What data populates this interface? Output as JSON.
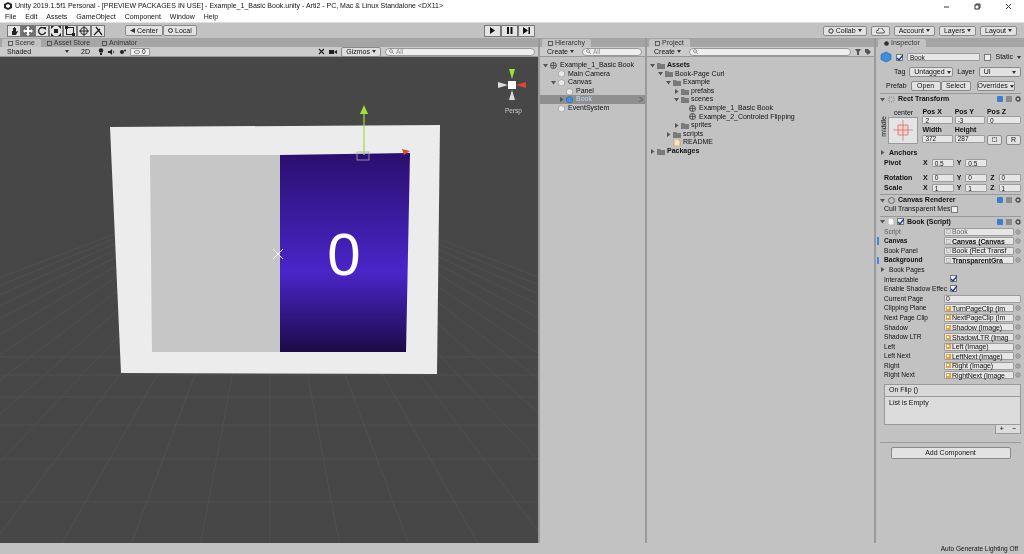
{
  "window": {
    "title": "Unity 2019.1.5f1 Personal - [PREVIEW PACKAGES IN USE] - Example_1_Basic Book.unity - Arti2 - PC, Mac & Linux Standalone <DX11>"
  },
  "menu": [
    "File",
    "Edit",
    "Assets",
    "GameObject",
    "Component",
    "Window",
    "Help"
  ],
  "toolbar": {
    "tools": [
      {
        "kind": "hand",
        "selected": false
      },
      {
        "kind": "move",
        "selected": true
      },
      {
        "kind": "rotate",
        "selected": false
      },
      {
        "kind": "scale",
        "selected": false
      },
      {
        "kind": "rect",
        "selected": false
      },
      {
        "kind": "transform",
        "selected": false
      },
      {
        "kind": "custom",
        "selected": false
      }
    ],
    "pivot": [
      {
        "kind": "pivot",
        "label": "Center"
      },
      {
        "kind": "space",
        "label": "Local"
      }
    ],
    "right": [
      {
        "kind": "collab",
        "label": "Collab"
      },
      {
        "kind": "cloud"
      },
      {
        "kind": "menu",
        "label": "Account"
      },
      {
        "kind": "menu",
        "label": "Layers"
      },
      {
        "kind": "menu",
        "label": "Layout"
      }
    ]
  },
  "scene": {
    "tabs": [
      {
        "label": "Scene",
        "selected": true
      },
      {
        "label": "Asset Store",
        "selected": false
      },
      {
        "label": "Animator",
        "selected": false
      }
    ],
    "shading": "Shaded",
    "mode_2d": "2D",
    "hidden_count": "0",
    "gizmos": "Gizmos",
    "search_placeholder": "All",
    "projection": "Persp",
    "page_number": "0"
  },
  "hierarchy": {
    "title": "Hierarchy",
    "create": "Create",
    "search_placeholder": "All",
    "items": [
      {
        "label": "Example_1_Basic Book",
        "kind": "scene",
        "expanded": true,
        "selected": false,
        "children": [
          {
            "label": "Main Camera",
            "kind": "object",
            "selected": false
          },
          {
            "label": "Canvas",
            "kind": "object",
            "expanded": true,
            "selected": false,
            "children": [
              {
                "label": "Panel",
                "kind": "object",
                "selected": false
              },
              {
                "label": "Book",
                "kind": "prefab",
                "expanded": false,
                "selected": true
              }
            ]
          },
          {
            "label": "EventSystem",
            "kind": "object",
            "selected": false
          }
        ]
      }
    ]
  },
  "project": {
    "title": "Project",
    "create": "Create",
    "items": [
      {
        "label": "Assets",
        "kind": "folder",
        "bold": true,
        "expanded": true,
        "children": [
          {
            "label": "Book-Page Curl",
            "kind": "folder",
            "expanded": true,
            "children": [
              {
                "label": "Example",
                "kind": "folder",
                "expanded": true,
                "children": [
                  {
                    "label": "prefabs",
                    "kind": "folder",
                    "expanded": false
                  },
                  {
                    "label": "scenes",
                    "kind": "folder",
                    "expanded": true,
                    "children": [
                      {
                        "label": "Example_1_Basic Book",
                        "kind": "scene"
                      },
                      {
                        "label": "Example_2_Controled Flipping",
                        "kind": "scene"
                      }
                    ]
                  },
                  {
                    "label": "sprites",
                    "kind": "folder",
                    "expanded": false
                  }
                ]
              },
              {
                "label": "scripts",
                "kind": "folder",
                "expanded": false
              },
              {
                "label": "README",
                "kind": "text"
              }
            ]
          }
        ]
      },
      {
        "label": "Packages",
        "kind": "folder",
        "bold": true,
        "expanded": false
      }
    ]
  },
  "inspector": {
    "title": "Inspector",
    "active": true,
    "name": "Book",
    "static_label": "Static",
    "static": false,
    "tag_label": "Tag",
    "tag": "Untagged",
    "layer_label": "Layer",
    "layer": "UI",
    "prefab_label": "Prefab",
    "prefab_buttons": [
      "Open",
      "Select",
      "Overrides"
    ],
    "rect_transform": {
      "title": "Rect Transform",
      "anchor_h": "center",
      "anchor_v": "middle",
      "fields": [
        {
          "label": "Pos X",
          "value": "2"
        },
        {
          "label": "Pos Y",
          "value": "-3"
        },
        {
          "label": "Pos Z",
          "value": "0"
        },
        {
          "label": "Width",
          "value": "372"
        },
        {
          "label": "Height",
          "value": "287"
        }
      ],
      "raw_button": "R",
      "anchors": {
        "label": "Anchors",
        "expanded": false
      },
      "vectors": [
        {
          "label": "Pivot",
          "axes": [
            {
              "axis": "X",
              "value": "0.5"
            },
            {
              "axis": "Y",
              "value": "0.5"
            }
          ]
        },
        {
          "label": "Rotation",
          "axes": [
            {
              "axis": "X",
              "value": "0"
            },
            {
              "axis": "Y",
              "value": "0"
            },
            {
              "axis": "Z",
              "value": "0"
            }
          ]
        },
        {
          "label": "Scale",
          "axes": [
            {
              "axis": "X",
              "value": "1"
            },
            {
              "axis": "Y",
              "value": "1"
            },
            {
              "axis": "Z",
              "value": "1"
            }
          ]
        }
      ]
    },
    "canvas_renderer": {
      "title": "Canvas Renderer",
      "option": "Cull Transparent Mes",
      "checked": false
    },
    "script": {
      "title": "Book (Script)",
      "enabled": true,
      "properties": [
        {
          "kind": "script",
          "label": "Script",
          "value": "Book"
        },
        {
          "kind": "object",
          "label": "Canvas",
          "value": "Canvas (Canvas",
          "overridden": true
        },
        {
          "kind": "object",
          "label": "Book Panel",
          "value": "Book (Rect Transf",
          "overridden": false
        },
        {
          "kind": "object",
          "label": "Background",
          "value": "TransparentGra",
          "overridden": true
        },
        {
          "kind": "foldout",
          "label": "Book Pages",
          "expanded": false
        },
        {
          "kind": "checkbox",
          "label": "Interactable",
          "checked": true
        },
        {
          "kind": "checkbox",
          "label": "Enable Shadow Effec",
          "checked": true
        },
        {
          "kind": "text",
          "label": "Current Page",
          "value": "0"
        },
        {
          "kind": "image",
          "label": "Clipping Plane",
          "value": "TurnPageClip (Im"
        },
        {
          "kind": "image",
          "label": "Next Page Clip",
          "value": "NextPageClip (Im"
        },
        {
          "kind": "image",
          "label": "Shadow",
          "value": "Shadow (Image)"
        },
        {
          "kind": "image",
          "label": "Shadow LTR",
          "value": "ShadowLTR (Imag"
        },
        {
          "kind": "image",
          "label": "Left",
          "value": "Left (Image)"
        },
        {
          "kind": "image",
          "label": "Left Next",
          "value": "LeftNext (Image)"
        },
        {
          "kind": "image",
          "label": "Right",
          "value": "Right (Image)"
        },
        {
          "kind": "image",
          "label": "Right Next",
          "value": "RightNext (Image"
        }
      ],
      "event": {
        "title": "On Flip ()",
        "empty": "List is Empty",
        "add": "+",
        "remove": "−"
      }
    },
    "add_component": "Add Component"
  },
  "status_bar": "Auto Generate Lighting Off"
}
